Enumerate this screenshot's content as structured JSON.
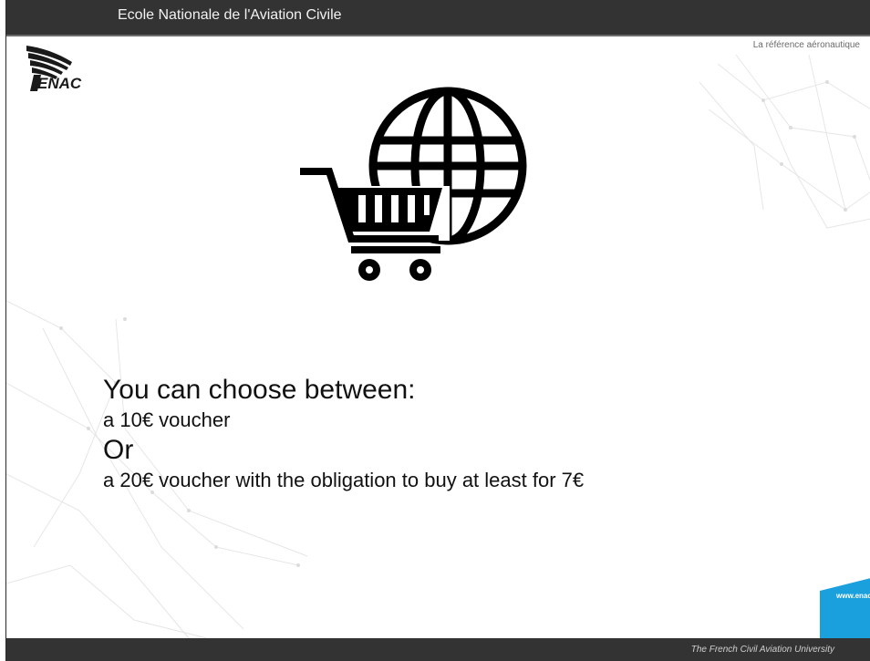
{
  "header": {
    "institution": "Ecole Nationale de l'Aviation Civile",
    "tagline": "La référence aéronautique"
  },
  "logo": {
    "text": "ENAC",
    "icon": "enac-wing-logo"
  },
  "illustration": {
    "icons": [
      "globe-icon",
      "shopping-cart-icon"
    ]
  },
  "content": {
    "line1": "You can choose between:",
    "line2": "a 10€ voucher",
    "line3": "Or",
    "line4": "a 20€ voucher with the obligation to buy at least for 7€"
  },
  "footer": {
    "url": "www.enac.",
    "text": "The French Civil Aviation University"
  },
  "colors": {
    "bar": "#333333",
    "accent": "#1aa0dc",
    "text": "#111111"
  }
}
